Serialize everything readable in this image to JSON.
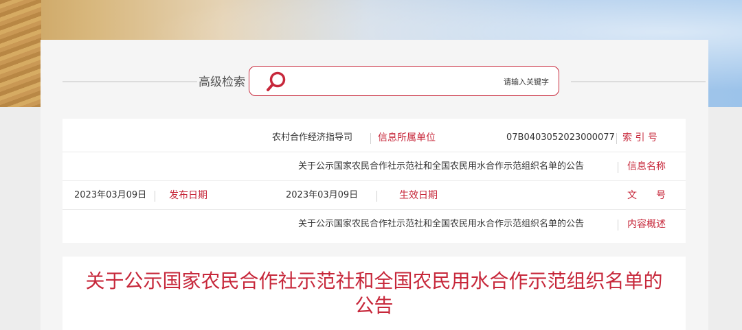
{
  "search": {
    "advanced_label": "高级检索",
    "placeholder": "请输入关键字"
  },
  "info": {
    "index_label": "索 引 号",
    "index_value": "07B0403052023000077",
    "unit_label": "信息所属单位",
    "unit_value": "农村合作经济指导司",
    "name_label": "信息名称",
    "name_value": "关于公示国家农民合作社示范社和全国农民用水合作示范组织名单的公告",
    "doc_label": "文　　号",
    "doc_value": "",
    "effective_label": "生效日期",
    "effective_value": "2023年03月09日",
    "publish_label": "发布日期",
    "publish_value": "2023年03月09日",
    "summary_label": "内容概述",
    "summary_value": "关于公示国家农民合作社示范社和全国农民用水合作示范组织名单的公告"
  },
  "document": {
    "title": "关于公示国家农民合作社示范社和全国农民用水合作示范组织名单的公告"
  },
  "colors": {
    "accent": "#c7283b",
    "panel_bg": "#f5f5f5"
  },
  "icons": {
    "search": "search-icon"
  }
}
